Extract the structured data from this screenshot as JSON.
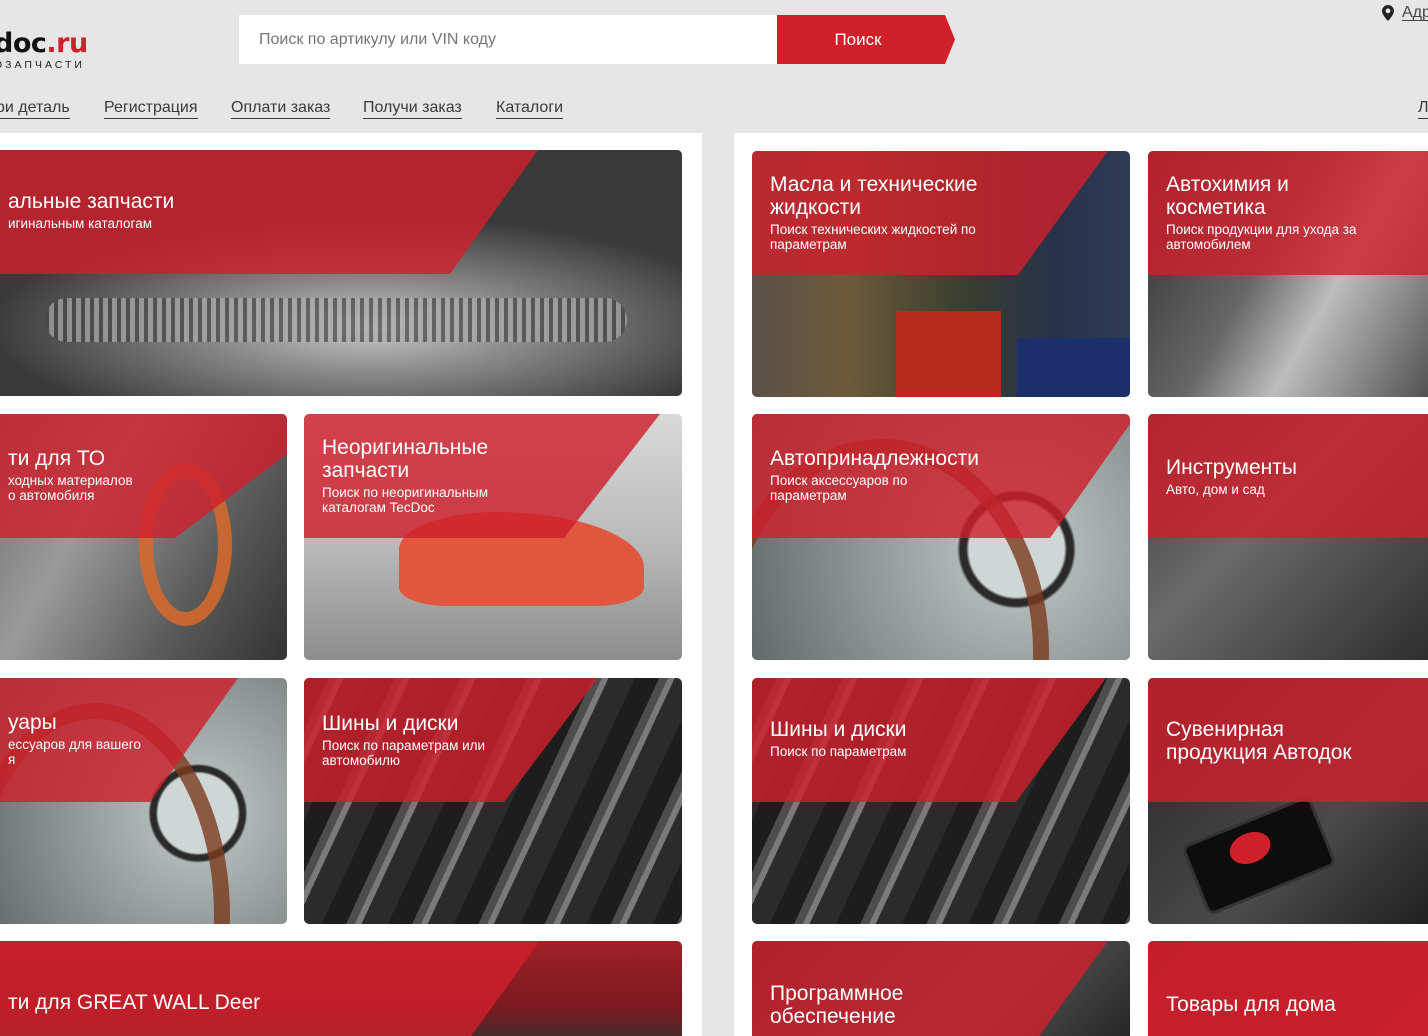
{
  "header": {
    "logo_main": "doc",
    "logo_suffix": ".ru",
    "logo_sub": "ОЗАПЧАСТИ",
    "search_placeholder": "Поиск по артикулу или VIN коду",
    "search_button": "Поиск",
    "address_link": "Адр"
  },
  "nav": [
    {
      "label": "ри деталь"
    },
    {
      "label": "Регистрация"
    },
    {
      "label": "Оплати заказ"
    },
    {
      "label": "Получи заказ"
    },
    {
      "label": "Каталоги"
    },
    {
      "label": "Л"
    }
  ],
  "left_cards": [
    {
      "title": "альные запчасти",
      "subtitle": "игинальным каталогам",
      "image": "classic-car"
    },
    {
      "title": "ти для ТО",
      "subtitle": "ходных материалов\n о автомобиля",
      "image": "suspension-parts"
    },
    {
      "title": "Неоригинальные\nзапчасти",
      "subtitle": "Поиск по неоригинальным\nкаталогам TecDoc",
      "image": "porsche-garage"
    },
    {
      "title": "уары",
      "subtitle": "ессуаров для вашего\nя",
      "image": "dashboard"
    },
    {
      "title": "Шины и диски",
      "subtitle": "Поиск по параметрам или\nавтомобилю",
      "image": "tire"
    },
    {
      "title": "ти для GREAT WALL Deer",
      "subtitle": "",
      "image": "truck"
    }
  ],
  "right_cards": [
    {
      "title": "Масла и технические\nжидкости",
      "subtitle": "Поиск технических жидкостей по\nпараметрам",
      "image": "oil-cans"
    },
    {
      "title": "Автохимия и\nкосметика",
      "subtitle": "Поиск продукции для ухода за\nавтомобилем",
      "image": "car-care"
    },
    {
      "title": "Автопринадлежности",
      "subtitle": "Поиск аксессуаров по\nпараметрам",
      "image": "dashboard"
    },
    {
      "title": "Инструменты",
      "subtitle": "Авто, дом и сад",
      "image": "tools"
    },
    {
      "title": "Шины и диски",
      "subtitle": "Поиск по параметрам",
      "image": "tire"
    },
    {
      "title": "Сувенирная\nпродукция Автодок",
      "subtitle": "",
      "image": "phone"
    },
    {
      "title": "Программное\nобеспечение",
      "subtitle": "",
      "image": "software"
    },
    {
      "title": "Товары для дома",
      "subtitle": "",
      "image": "home"
    }
  ],
  "colors": {
    "accent": "#d0202a",
    "overlay": "#ce202c",
    "panel": "#ffffff",
    "page": "#e6e6e6"
  }
}
